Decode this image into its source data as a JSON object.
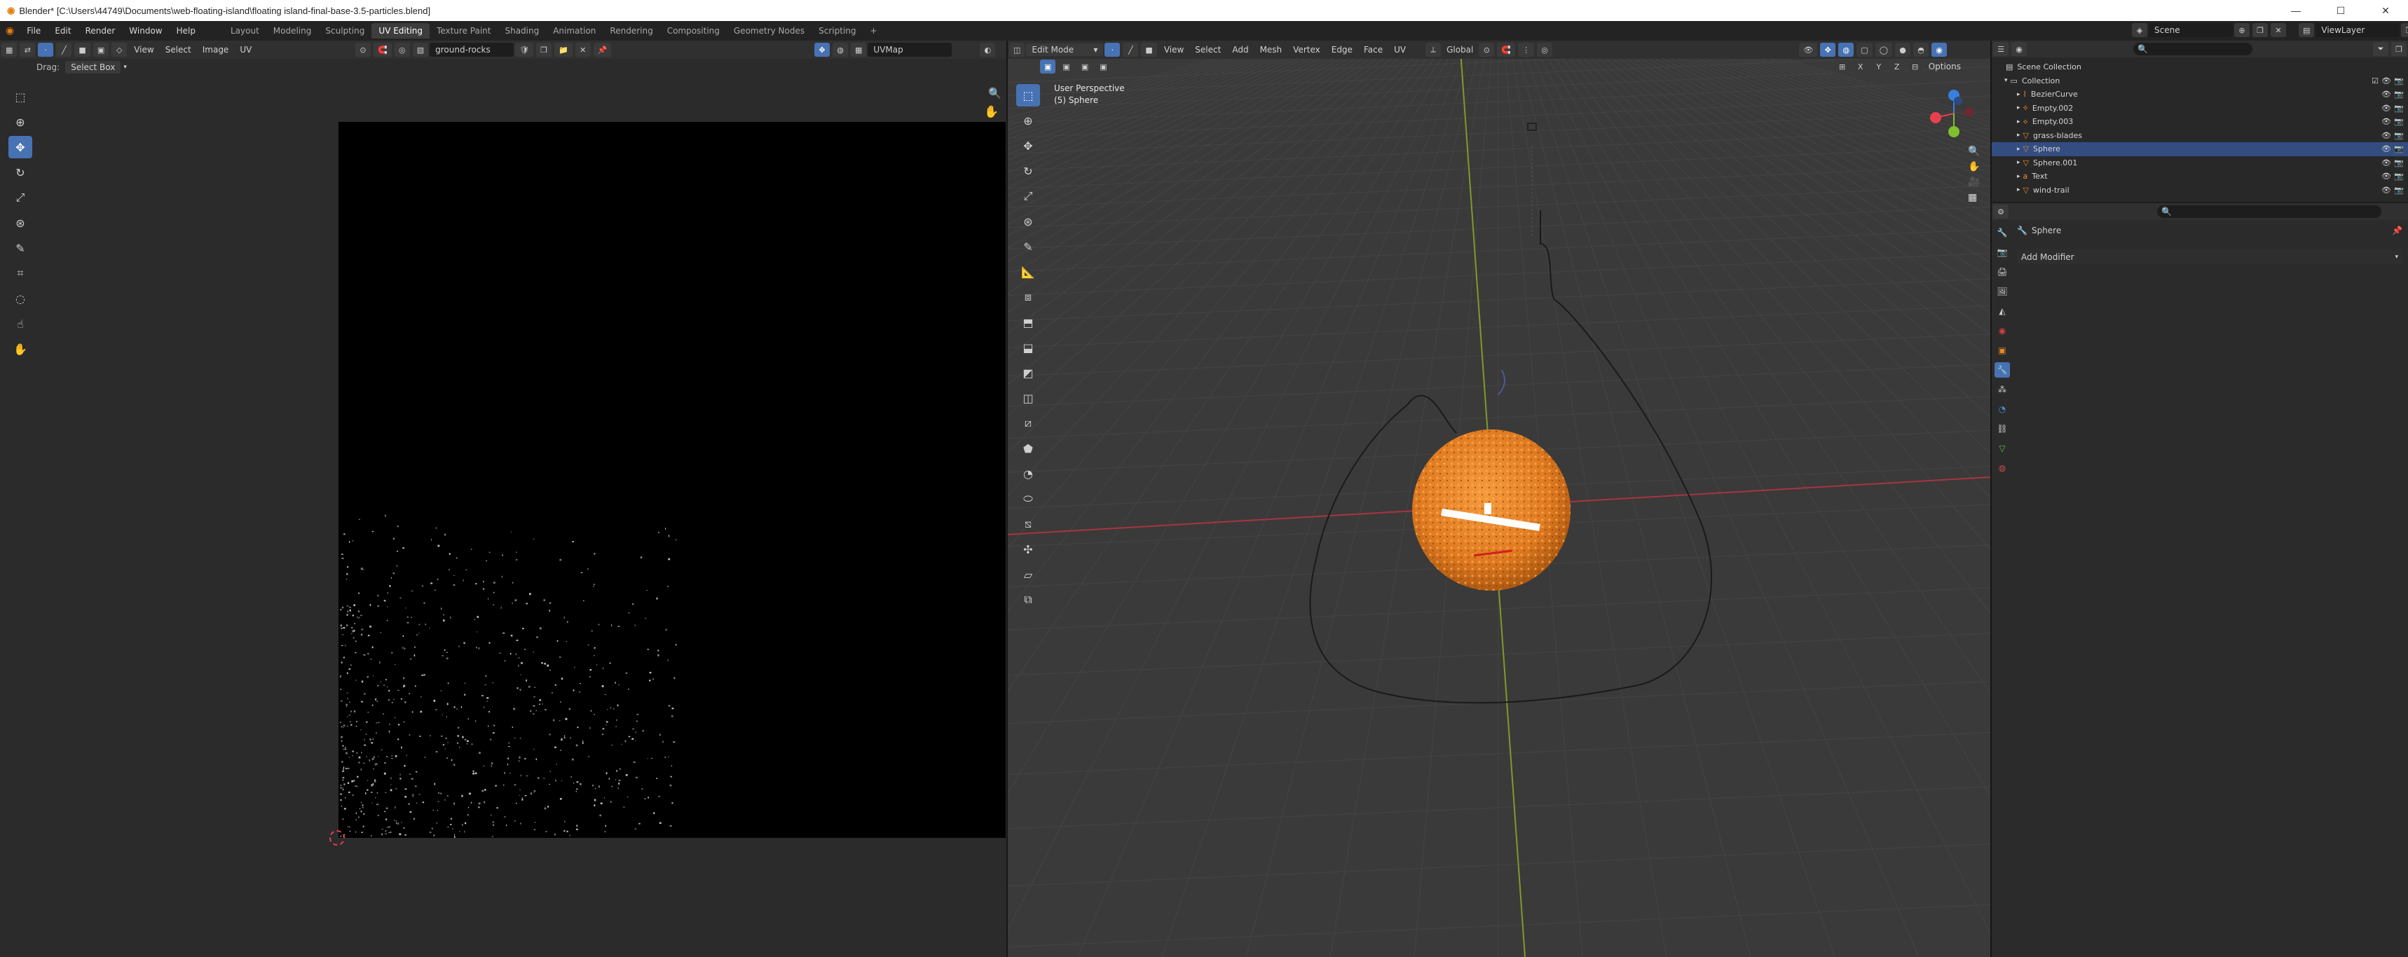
{
  "window": {
    "title": "Blender* [C:\\Users\\44749\\Documents\\web-floating-island\\floating island-final-base-3.5-particles.blend]",
    "controls": {
      "minimize": "—",
      "maximize": "☐",
      "close": "✕"
    }
  },
  "topbar": {
    "menus": [
      "File",
      "Edit",
      "Render",
      "Window",
      "Help"
    ],
    "workspaces": [
      "Layout",
      "Modeling",
      "Sculpting",
      "UV Editing",
      "Texture Paint",
      "Shading",
      "Animation",
      "Rendering",
      "Compositing",
      "Geometry Nodes",
      "Scripting"
    ],
    "active_workspace": "UV Editing",
    "add_tab": "+",
    "scene_label": "Scene",
    "viewlayer_label": "ViewLayer"
  },
  "uv_editor": {
    "menus": [
      "View",
      "Select",
      "Image",
      "UV"
    ],
    "image_name": "ground-rocks",
    "uvmap_name": "UVMap",
    "drag_label": "Drag:",
    "drag_value": "Select Box"
  },
  "viewport": {
    "mode": "Edit Mode",
    "menus": [
      "View",
      "Select",
      "Add",
      "Mesh",
      "Vertex",
      "Edge",
      "Face",
      "UV"
    ],
    "transform_orientation": "Global",
    "options_label": "Options",
    "view_name": "User Perspective",
    "object_label": "(5) Sphere",
    "gizmo": {
      "x": "X",
      "y": "Y",
      "z": "Z"
    }
  },
  "outliner": {
    "root": "Scene Collection",
    "collection": "Collection",
    "items": [
      {
        "name": "BezierCurve",
        "selected": false
      },
      {
        "name": "Empty.002",
        "selected": false
      },
      {
        "name": "Empty.003",
        "selected": false
      },
      {
        "name": "grass-blades",
        "selected": false
      },
      {
        "name": "Sphere",
        "selected": true
      },
      {
        "name": "Sphere.001",
        "selected": false
      },
      {
        "name": "Text",
        "selected": false
      },
      {
        "name": "wind-trail",
        "selected": false
      }
    ]
  },
  "properties": {
    "object_name": "Sphere",
    "add_modifier": "Add Modifier"
  },
  "colors": {
    "accent": "#4772b3",
    "object_orange": "#e8822a",
    "x_axis": "#a8353f",
    "y_axis": "#7f9a2a",
    "gizmo_x": "#e8404f",
    "gizmo_y": "#7fc02e",
    "gizmo_z": "#3a7fe0"
  }
}
